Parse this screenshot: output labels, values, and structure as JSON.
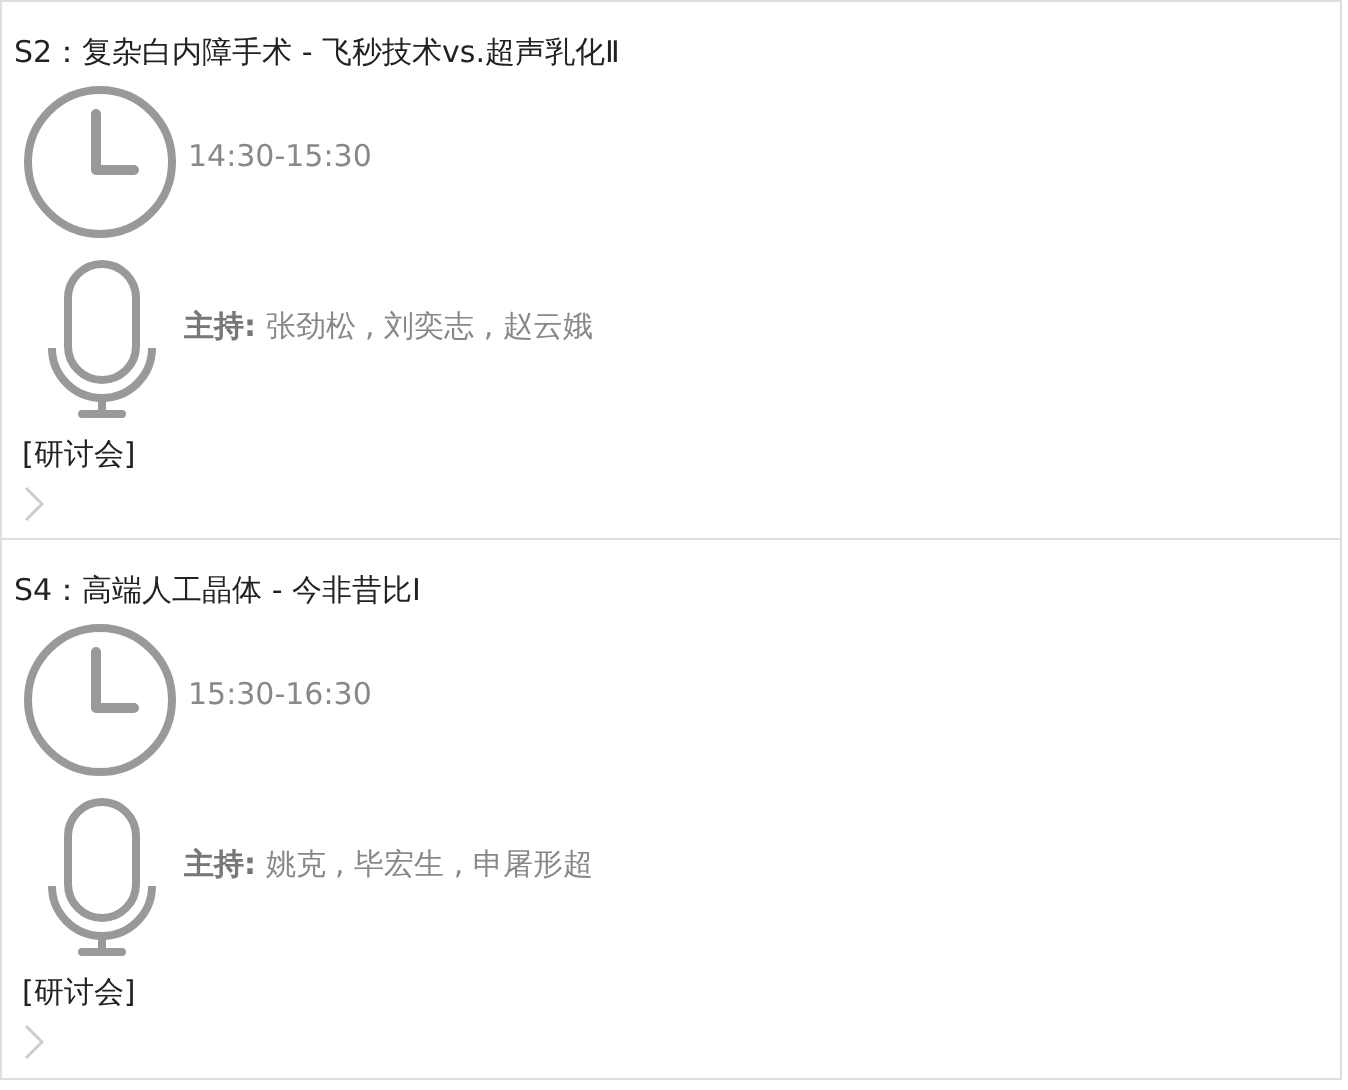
{
  "sessions": [
    {
      "title": "S2：复杂白内障手术 - 飞秒技术vs.超声乳化Ⅱ",
      "time": "14:30-15:30",
      "hosts": "**主持:** 张劲松 , 刘奕志 , 赵云娥",
      "tag": "[研讨会]"
    },
    {
      "title": "S4：高端人工晶体 - 今非昔比Ⅰ",
      "time": "15:30-16:30",
      "hosts": "**主持:** 姚克 , 毕宏生 , 申屠形超",
      "tag": "[研讨会]"
    }
  ]
}
